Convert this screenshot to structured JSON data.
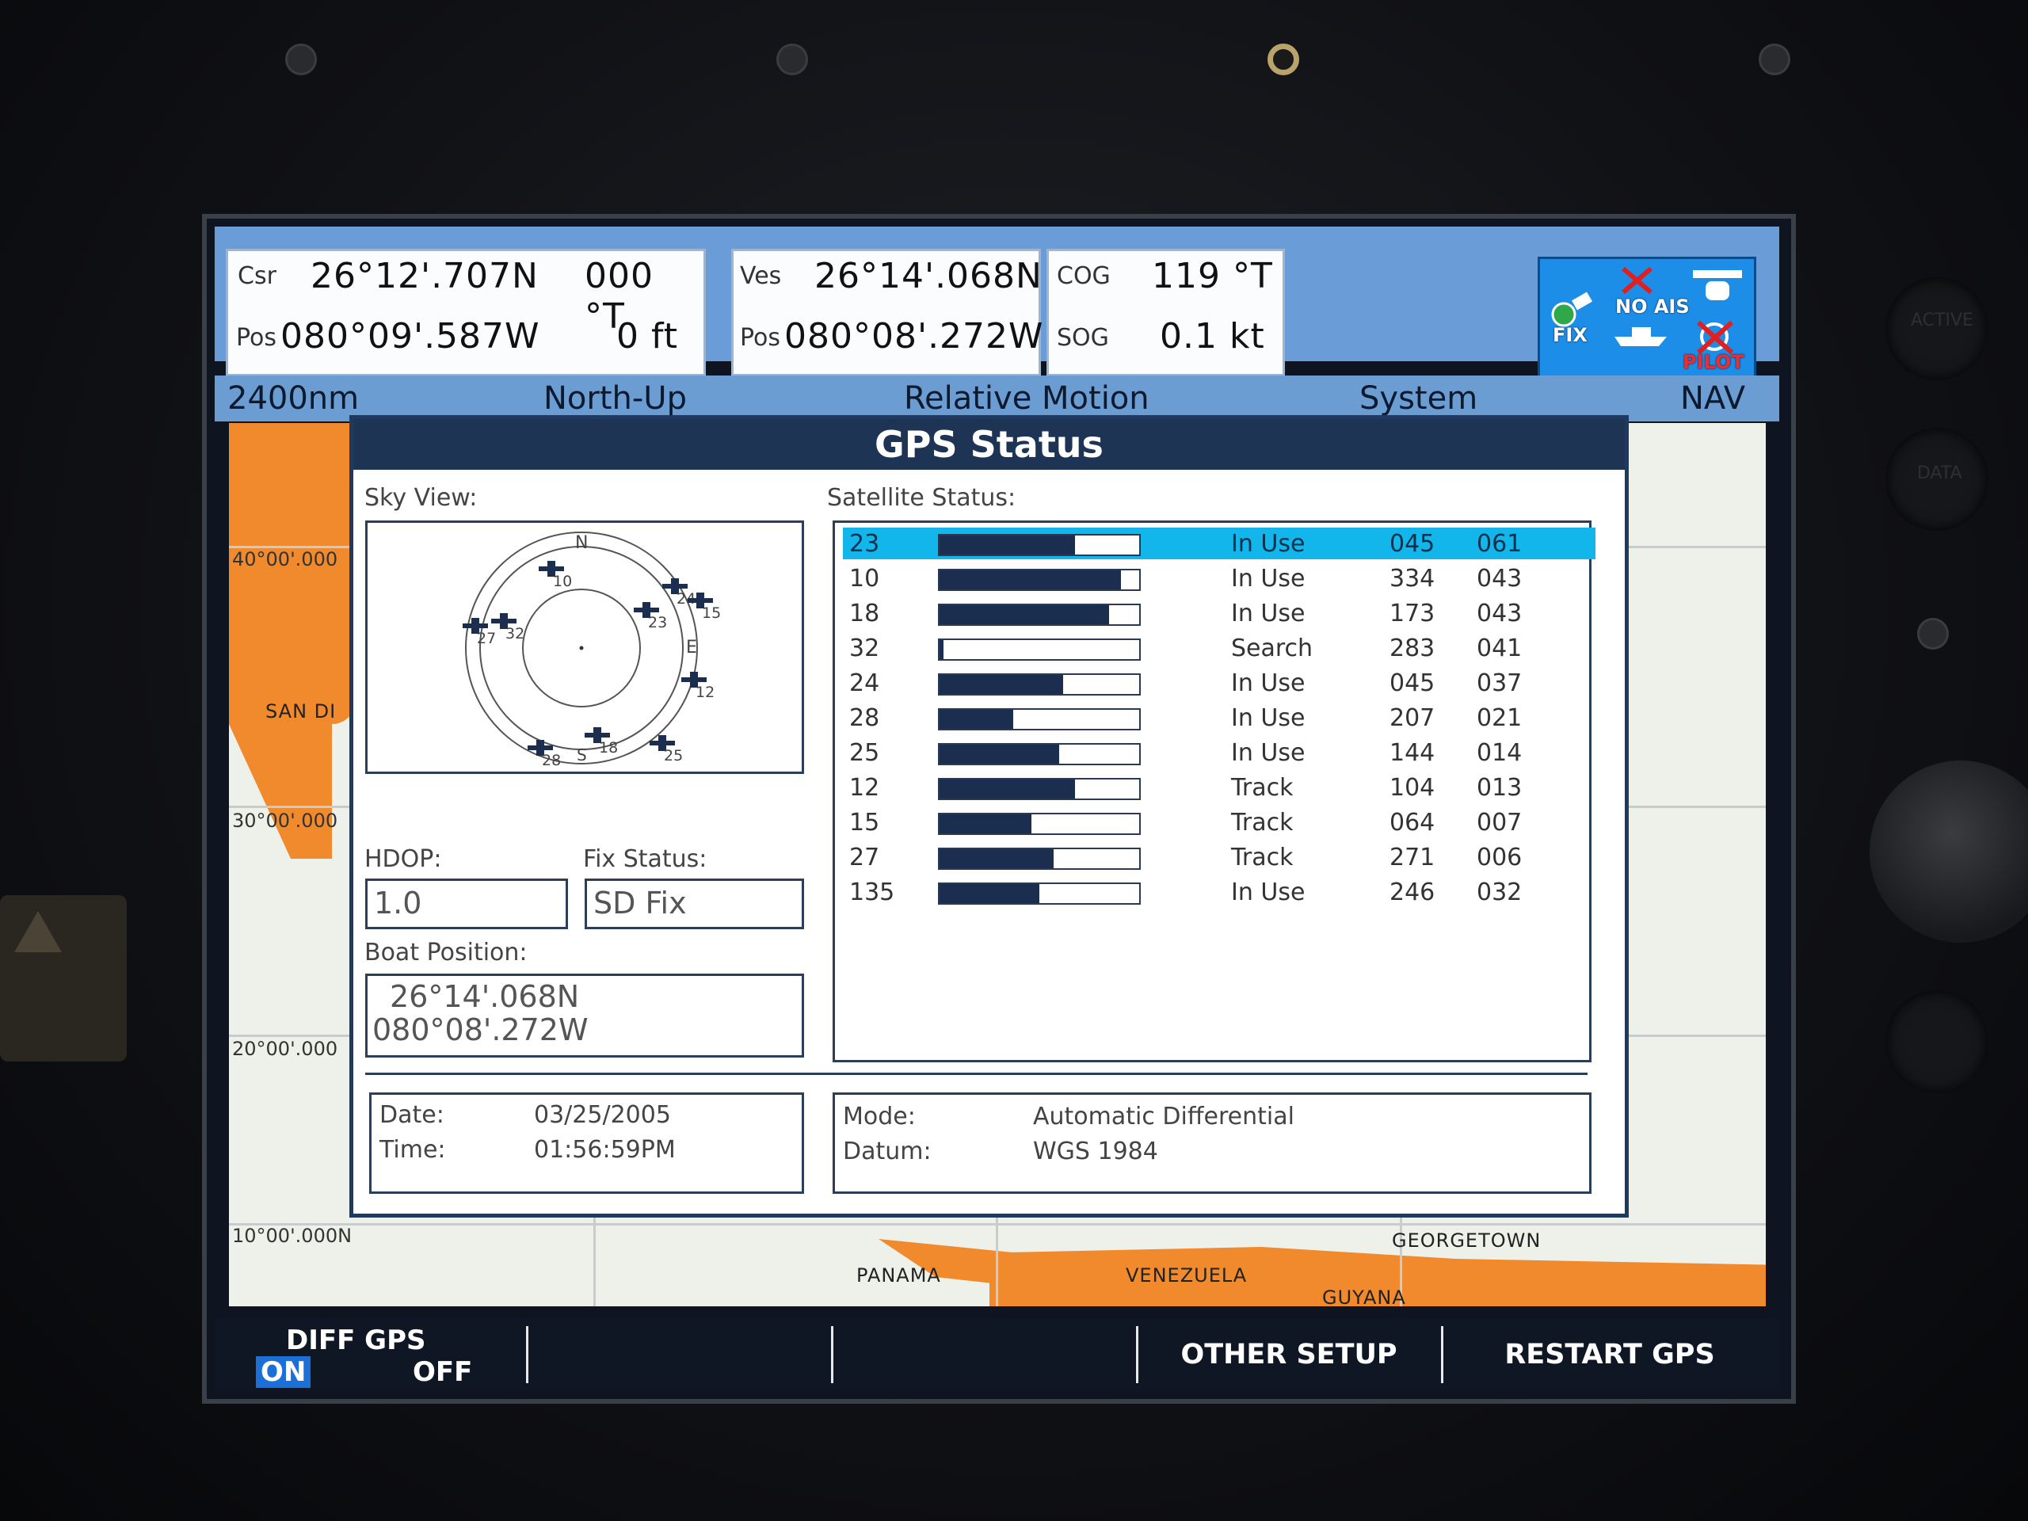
{
  "nav_bar": {
    "cursor": {
      "label": "Csr",
      "pos_label": "Pos",
      "lat": "26°12'.707N",
      "lon": "080°09'.587W",
      "bearing": "000 °T",
      "depth": "0 ft"
    },
    "vessel": {
      "label": "Ves",
      "pos_label": "Pos",
      "lat": "26°14'.068N",
      "lon": "080°08'.272W"
    },
    "motion": {
      "cog_label": "COG",
      "cog": "119 °T",
      "sog_label": "SOG",
      "sog": "0.1 kt"
    },
    "status_icons": {
      "fix": "FIX",
      "ais": "NO AIS",
      "pilot": "PILOT"
    }
  },
  "status_strip": {
    "range": "2400nm",
    "orientation": "North-Up",
    "motion": "Relative Motion",
    "menu": "System",
    "mode": "NAV"
  },
  "chart": {
    "lat_labels": [
      "40°00'.000",
      "30°00'.000",
      "20°00'.000",
      "10°00'.000N"
    ],
    "places": [
      "SAN DI",
      "PANAMA",
      "VENEZUELA",
      "GEORGETOWN",
      "GUYANA"
    ]
  },
  "dialog": {
    "title": "GPS Status",
    "sky_view_label": "Sky View:",
    "sky_marks": {
      "n": "N",
      "e": "E",
      "s": "S"
    },
    "sky_sat_ids": [
      "10",
      "24",
      "15",
      "23",
      "32",
      "27",
      "12",
      "28",
      "18",
      "25"
    ],
    "satellite_status_label": "Satellite Status:",
    "satellites": [
      {
        "id": "23",
        "signal": 0.68,
        "status": "In Use",
        "azimuth": "045",
        "elevation": "061",
        "selected": true
      },
      {
        "id": "10",
        "signal": 0.91,
        "status": "In Use",
        "azimuth": "334",
        "elevation": "043"
      },
      {
        "id": "18",
        "signal": 0.85,
        "status": "In Use",
        "azimuth": "173",
        "elevation": "043"
      },
      {
        "id": "32",
        "signal": 0.02,
        "status": "Search",
        "azimuth": "283",
        "elevation": "041"
      },
      {
        "id": "24",
        "signal": 0.62,
        "status": "In Use",
        "azimuth": "045",
        "elevation": "037"
      },
      {
        "id": "28",
        "signal": 0.37,
        "status": "In Use",
        "azimuth": "207",
        "elevation": "021"
      },
      {
        "id": "25",
        "signal": 0.6,
        "status": "In Use",
        "azimuth": "144",
        "elevation": "014"
      },
      {
        "id": "12",
        "signal": 0.68,
        "status": "Track",
        "azimuth": "104",
        "elevation": "013"
      },
      {
        "id": "15",
        "signal": 0.46,
        "status": "Track",
        "azimuth": "064",
        "elevation": "007"
      },
      {
        "id": "27",
        "signal": 0.57,
        "status": "Track",
        "azimuth": "271",
        "elevation": "006"
      },
      {
        "id": "135",
        "signal": 0.5,
        "status": "In Use",
        "azimuth": "246",
        "elevation": "032"
      }
    ],
    "hdop_label": "HDOP:",
    "hdop": "1.0",
    "fix_status_label": "Fix Status:",
    "fix_status": "SD Fix",
    "boat_position_label": "Boat Position:",
    "boat_lat": "26°14'.068N",
    "boat_lon": "080°08'.272W",
    "date_label": "Date:",
    "date": "03/25/2005",
    "time_label": "Time:",
    "time": "01:56:59PM",
    "mode_label": "Mode:",
    "mode": "Automatic Differential",
    "datum_label": "Datum:",
    "datum": "WGS 1984"
  },
  "softkeys": {
    "diff_gps": "DIFF GPS",
    "on": "ON",
    "off": "OFF",
    "other_setup": "OTHER SETUP",
    "restart_gps": "RESTART GPS"
  },
  "bezel": {
    "side_labels": [
      "ACTIVE",
      "DATA"
    ]
  }
}
